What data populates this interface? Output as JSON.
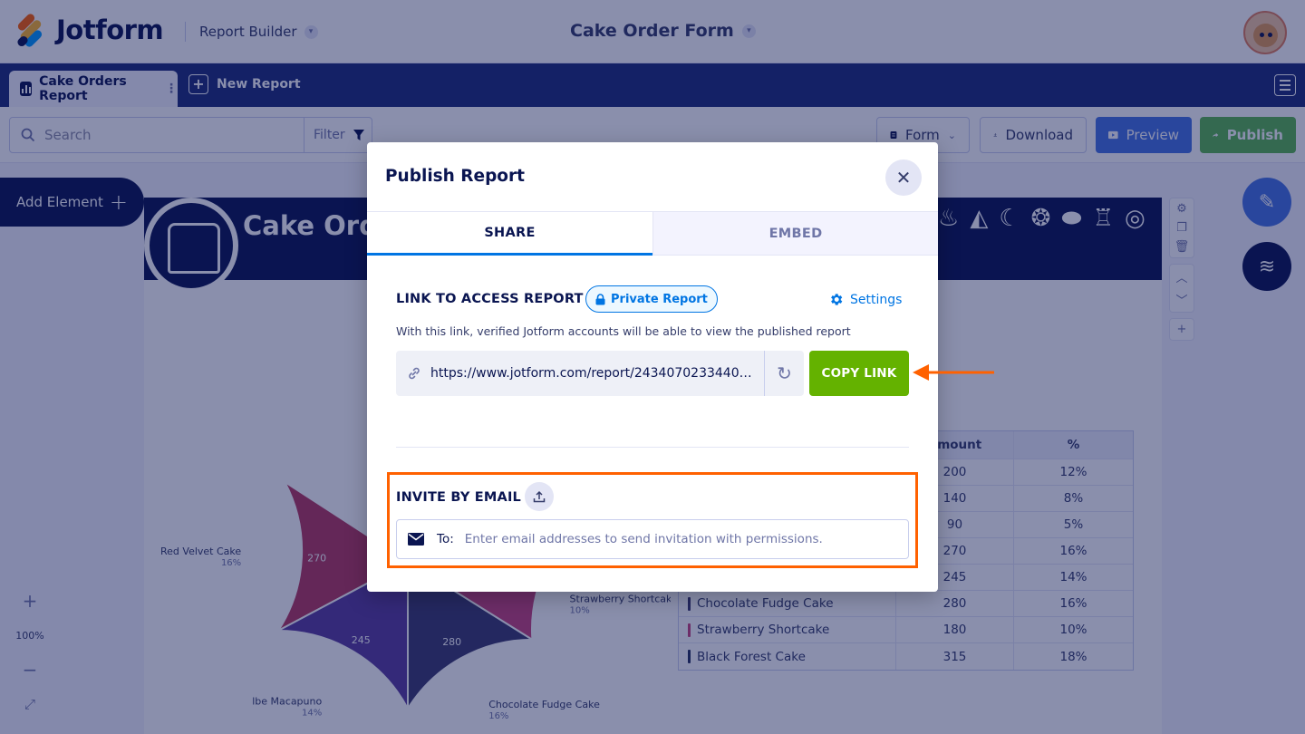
{
  "app": {
    "brand": "Jotform",
    "section": "Report Builder",
    "form_title": "Cake Order Form"
  },
  "tabs": {
    "active": "Cake Orders Report",
    "new": "New Report"
  },
  "toolbar": {
    "search_placeholder": "Search",
    "filter_label": "Filter",
    "form_label": "Form",
    "download_label": "Download",
    "preview_label": "Preview",
    "publish_label": "Publish"
  },
  "sidebar": {
    "add_element": "Add Element",
    "zoom": "100%"
  },
  "report": {
    "banner_title": "Cake Orders"
  },
  "chart_data": {
    "type": "pie",
    "categories": [
      "Red Velvet Cake",
      "Ube Macapuno",
      "Chocolate Fudge Cake",
      "Strawberry Shortcake",
      "Black Forest Cake"
    ],
    "visible_labels": [
      "Red Velvet Cake",
      "lbe Macapuno",
      "Chocolate Fudge Cake",
      "Strawberry Shortcake",
      "Black Forest Cake"
    ],
    "values": [
      270,
      245,
      280,
      180,
      315
    ],
    "percents": [
      "16%",
      "14%",
      "16%",
      "10%",
      "18%"
    ],
    "colors": [
      "#b6385e",
      "#5a3c9e",
      "#3d3a6e",
      "#c8447e",
      "#26305e"
    ]
  },
  "table": {
    "headers": [
      "",
      "Amount",
      "%"
    ],
    "rows": [
      {
        "name": "",
        "amount": "200",
        "pct": "12%",
        "color": ""
      },
      {
        "name": "",
        "amount": "140",
        "pct": "8%",
        "color": ""
      },
      {
        "name": "",
        "amount": "90",
        "pct": "5%",
        "color": ""
      },
      {
        "name": "",
        "amount": "270",
        "pct": "16%",
        "color": ""
      },
      {
        "name": "",
        "amount": "245",
        "pct": "14%",
        "color": ""
      },
      {
        "name": "Chocolate Fudge Cake",
        "amount": "280",
        "pct": "16%",
        "color": "#3d3a6e"
      },
      {
        "name": "Strawberry Shortcake",
        "amount": "180",
        "pct": "10%",
        "color": "#c8447e"
      },
      {
        "name": "Black Forest Cake",
        "amount": "315",
        "pct": "18%",
        "color": "#26305e"
      }
    ]
  },
  "modal": {
    "title": "Publish Report",
    "tab_share": "SHARE",
    "tab_embed": "EMBED",
    "link_heading": "LINK TO ACCESS REPORT",
    "private_badge": "Private Report",
    "settings_label": "Settings",
    "link_description": "With this link, verified Jotform accounts will be able to view the published report",
    "report_url": "https://www.jotform.com/report/2434070233440430...",
    "copy_button": "COPY LINK",
    "invite_heading": "INVITE BY EMAIL",
    "to_label": "To:",
    "email_placeholder": "Enter email addresses to send invitation with permissions."
  },
  "colors": {
    "navy": "#0a1551",
    "accent_blue": "#0075e3",
    "copy_green": "#64b200",
    "highlight_orange": "#ff6100"
  }
}
